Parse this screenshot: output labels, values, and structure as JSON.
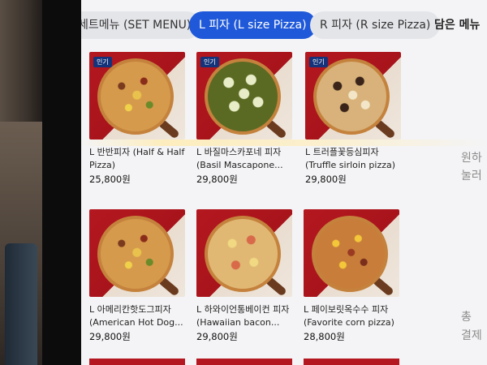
{
  "tabs": [
    {
      "label": "세트메뉴 (SET MENU)",
      "active": false
    },
    {
      "label": "L 피자 (L size Pizza)",
      "active": true
    },
    {
      "label": "R 피자 (R size Pizza)",
      "active": false
    }
  ],
  "cart": {
    "title": "담은 메뉴",
    "hint_line1": "원하",
    "hint_line2": "눌러",
    "total_fragment1": "총",
    "total_fragment2": "결제"
  },
  "products": [
    {
      "name": "L 반반피자 (Half & Half Pizza)",
      "price": "25,800원",
      "badge": "인기"
    },
    {
      "name": "L 바질마스카포네 피자 (Basil Mascapone...",
      "price": "29,800원",
      "badge": "인기"
    },
    {
      "name": "L 트러플꽃등심피자 (Truffle sirloin pizza)",
      "price": "29,800원",
      "badge": "인기"
    },
    {
      "name": "L 아메리칸핫도그피자 (American Hot Dog...",
      "price": "29,800원",
      "badge": ""
    },
    {
      "name": "L 하와이언통베이컨 피자 (Hawaiian bacon...",
      "price": "29,800원",
      "badge": ""
    },
    {
      "name": "L 페이보릿옥수수 피자 (Favorite corn pizza)",
      "price": "28,800원",
      "badge": ""
    }
  ],
  "colors": {
    "accent": "#1f59d9",
    "badge": "#14337a",
    "tile_red": "#b4171f"
  }
}
